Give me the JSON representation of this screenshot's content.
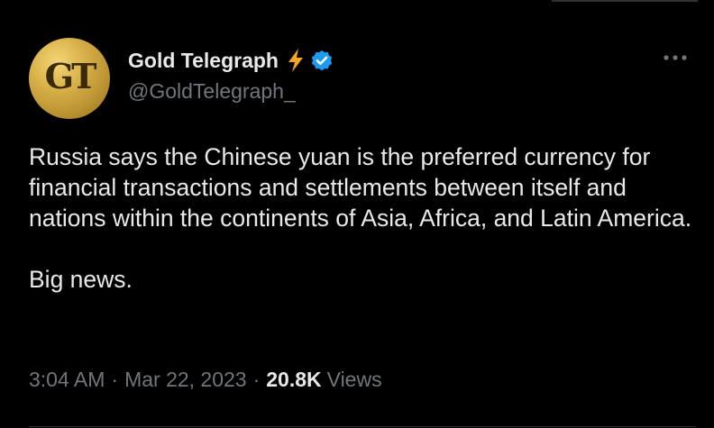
{
  "tweet": {
    "author": {
      "avatar_text": "GT",
      "display_name": "Gold Telegraph",
      "handle": "@GoldTelegraph_"
    },
    "icons": {
      "bolt": "lightning-bolt-icon",
      "verified": "verified-badge-icon",
      "more": "more-options-icon"
    },
    "text": {
      "paragraph_1": "Russia says the Chinese yuan is the preferred currency for financial transactions and settlements between itself and nations within the continents of Asia, Africa, and Latin America.",
      "paragraph_2": "Big news."
    },
    "meta": {
      "time": "3:04 AM",
      "separator": "·",
      "date": "Mar 22, 2023",
      "views_count": "20.8K",
      "views_label": "Views"
    },
    "colors": {
      "background": "#000000",
      "text": "#e7e9ea",
      "secondary_text": "#71767b",
      "verified_blue": "#1d9bf0",
      "bolt_orange": "#f6a623"
    }
  }
}
